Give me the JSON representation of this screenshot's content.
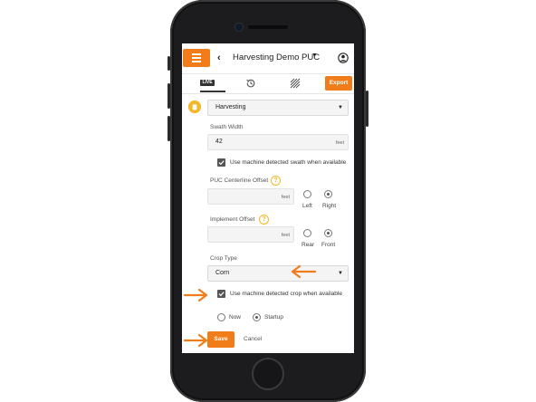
{
  "header": {
    "title": "Harvesting Demo PUC"
  },
  "tabs": {
    "live_label": "LIVE",
    "export_label": "Export"
  },
  "form": {
    "mode_select": {
      "value": "Harvesting"
    },
    "swath_width": {
      "label": "Swath Width",
      "value": "42",
      "unit": "feet"
    },
    "swath_auto": {
      "label": "Use machine detected swath when available",
      "checked": true
    },
    "centerline_offset": {
      "label": "PUC Centerline Offset",
      "value": "",
      "unit": "feet",
      "options": [
        {
          "label": "Left",
          "selected": false
        },
        {
          "label": "Right",
          "selected": true
        }
      ]
    },
    "implement_offset": {
      "label": "Implement Offset",
      "value": "",
      "unit": "feet",
      "options": [
        {
          "label": "Rear",
          "selected": false
        },
        {
          "label": "Front",
          "selected": true
        }
      ]
    },
    "crop_type": {
      "label": "Crop Type",
      "value": "Corn"
    },
    "crop_auto": {
      "label": "Use machine detected crop when available",
      "checked": true
    },
    "apply_when": {
      "options": [
        {
          "label": "Now",
          "selected": false
        },
        {
          "label": "Startup",
          "selected": true
        }
      ]
    },
    "help_glyph": "?"
  },
  "actions": {
    "save_label": "Save",
    "cancel_label": "Cancel"
  },
  "colors": {
    "accent": "#f07d1a",
    "help": "#f4b728",
    "arrow": "#f07d1a"
  }
}
